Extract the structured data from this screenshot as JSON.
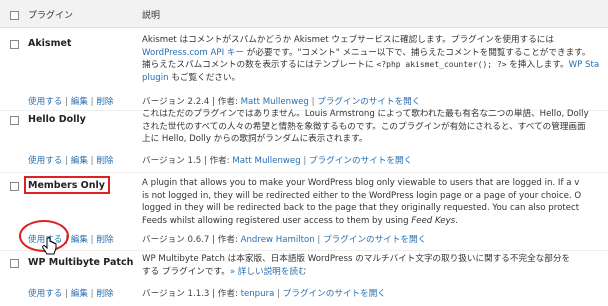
{
  "header": {
    "plugin_col": "プラグイン",
    "desc_col": "説明"
  },
  "plugins": [
    {
      "name": "Akismet",
      "desc_lines": [
        [
          {
            "t": "Akismet はコメントがスパムかどうか Akismet ウェブサービスに確認します。プラグインを使用するには"
          }
        ],
        [
          {
            "t": "WordPress.com API キー",
            "link": true
          },
          {
            "t": " が必要です。\"コメント\" メニュー以下で、捕らえたコメントを閲覧することができます。"
          }
        ],
        [
          {
            "t": "捕らえたスパムコメントの数を表示するにはテンプレートに "
          },
          {
            "t": "<?php akismet_counter(); ?>",
            "code": true
          },
          {
            "t": " を挿入します。"
          },
          {
            "t": "WP Sta",
            "link": true
          }
        ],
        [
          {
            "t": "plugin",
            "link": true
          },
          {
            "t": " もご覧ください。"
          }
        ]
      ],
      "actions": [
        "使用する",
        "編集",
        "削除"
      ],
      "version_label": "バージョン 2.2.4",
      "author_label": "作者:",
      "author": "Matt Mullenweg",
      "site": "プラグインのサイトを開く"
    },
    {
      "name": "Hello Dolly",
      "desc_lines": [
        [
          {
            "t": "これはただのプラグインではありません。Louis Armstrong によって歌われた最も有名な二つの単語、Hello, Dolly"
          }
        ],
        [
          {
            "t": "された世代のすべての人々の希望と情熱を象徴するものです。このプラグインが有効にされると、すべての管理画面"
          }
        ],
        [
          {
            "t": "上に Hello, Dolly からの歌詞がランダムに表示されます。"
          }
        ]
      ],
      "actions": [
        "使用する",
        "編集",
        "削除"
      ],
      "version_label": "バージョン 1.5",
      "author_label": "作者:",
      "author": "Matt Mullenweg",
      "site": "プラグインのサイトを開く"
    },
    {
      "name": "Members Only",
      "desc_lines": [
        [
          {
            "t": "A plugin that allows you to make your WordPress blog only viewable to users that are logged in. If a v"
          }
        ],
        [
          {
            "t": "is not logged in, they will be redirected either to the WordPress login page or a page of your choice. O"
          }
        ],
        [
          {
            "t": "logged in they will be redirected back to the page that they originally requested. You can also protect"
          }
        ],
        [
          {
            "t": "Feeds whilst allowing registered user access to them by using "
          },
          {
            "t": "Feed Keys",
            "em": true
          },
          {
            "t": "."
          }
        ]
      ],
      "actions": [
        "使用する",
        "編集",
        "削除"
      ],
      "version_label": "バージョン 0.6.7",
      "author_label": "作者:",
      "author": "Andrew Hamilton",
      "site": "プラグインのサイトを開く"
    },
    {
      "name": "WP Multibyte Patch",
      "desc_lines": [
        [
          {
            "t": "WP Multibyte Patch は本家版、日本語版 WordPress のマルチバイト文字の取り扱いに関する不完全な部分を"
          }
        ],
        [
          {
            "t": "する プラグインです。"
          },
          {
            "t": "» 詳しい説明を読む",
            "link": true
          }
        ]
      ],
      "actions": [
        "使用する",
        "編集",
        "削除"
      ],
      "version_label": "バージョン 1.1.3",
      "author_label": "作者:",
      "author": "tenpura",
      "site": "プラグインのサイトを開く"
    }
  ]
}
